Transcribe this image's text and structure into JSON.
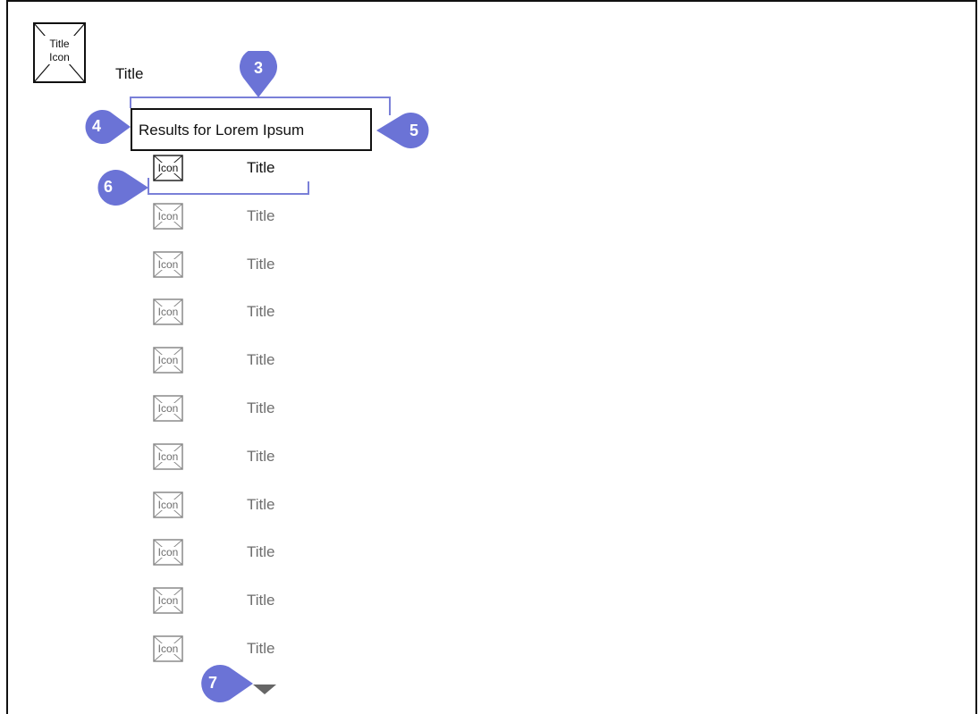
{
  "header": {
    "app_icon_label_1": "Title",
    "app_icon_label_2": "Icon",
    "title": "Title"
  },
  "search": {
    "value": "Results for Lorem Ipsum"
  },
  "results": [
    {
      "icon": "Icon",
      "title": "Title",
      "selected": true
    },
    {
      "icon": "Icon",
      "title": "Title",
      "selected": false
    },
    {
      "icon": "Icon",
      "title": "Title",
      "selected": false
    },
    {
      "icon": "Icon",
      "title": "Title",
      "selected": false
    },
    {
      "icon": "Icon",
      "title": "Title",
      "selected": false
    },
    {
      "icon": "Icon",
      "title": "Title",
      "selected": false
    },
    {
      "icon": "Icon",
      "title": "Title",
      "selected": false
    },
    {
      "icon": "Icon",
      "title": "Title",
      "selected": false
    },
    {
      "icon": "Icon",
      "title": "Title",
      "selected": false
    },
    {
      "icon": "Icon",
      "title": "Title",
      "selected": false
    },
    {
      "icon": "Icon",
      "title": "Title",
      "selected": false
    }
  ],
  "annotations": {
    "callout_3": "3",
    "callout_4": "4",
    "callout_5": "5",
    "callout_6": "6",
    "callout_7": "7"
  },
  "colors": {
    "callout": "#6b73d6",
    "bracket": "#7a80d8",
    "selected_text": "#111111",
    "muted_text": "#6e6e6e",
    "muted_icon": "#8a8a8a"
  },
  "icons": {
    "dropdown": "caret-down-icon",
    "placeholder": "image-placeholder-icon"
  }
}
